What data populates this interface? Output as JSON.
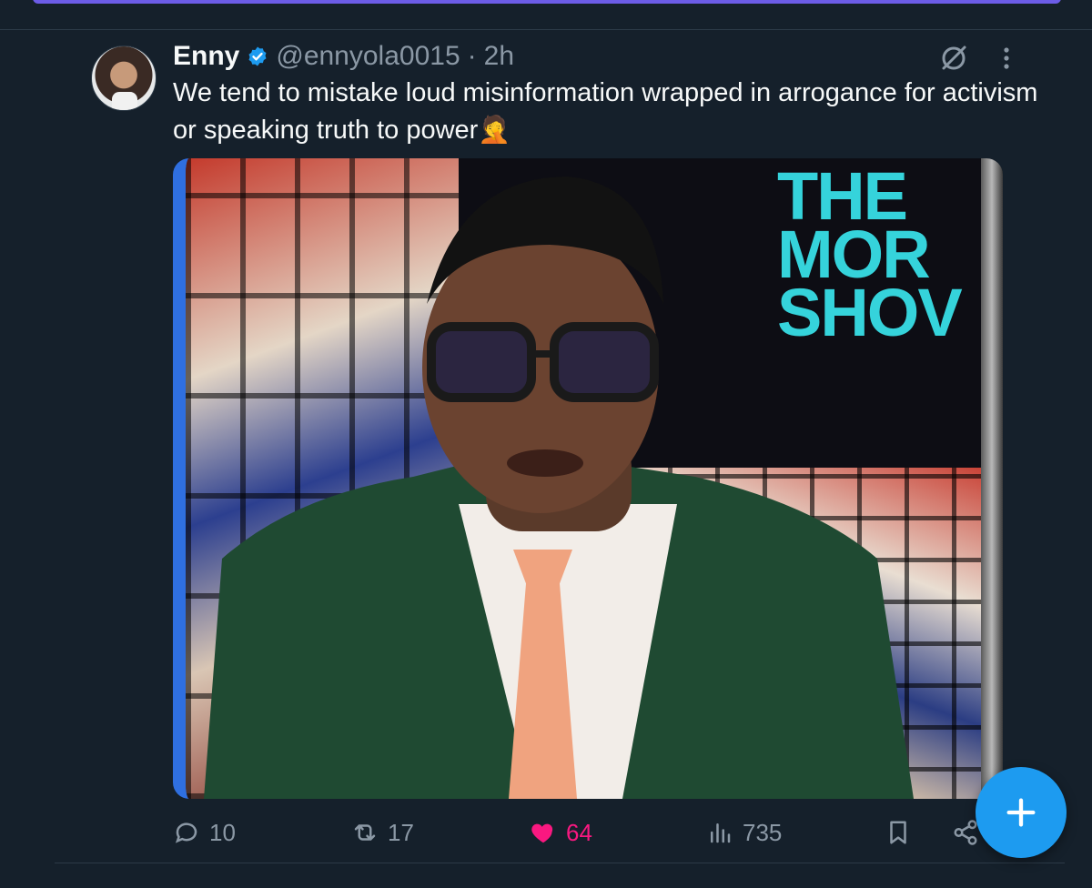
{
  "tweet": {
    "author_name": "Enny",
    "handle": "@ennyola0015",
    "separator": "·",
    "time": "2h",
    "text": "We tend to mistake loud misinformation wrapped in arrogance for activism or speaking truth to power🤦",
    "media_overlay_text": "THE\nMOR\nSHOV"
  },
  "actions": {
    "replies": "10",
    "reposts": "17",
    "likes": "64",
    "views": "735"
  },
  "colors": {
    "background": "#15202b",
    "accent": "#1d9bf0",
    "like": "#f91880",
    "secondary_text": "#8b98a5"
  },
  "icons": [
    "verified-badge-icon",
    "grok-icon",
    "more-icon",
    "reply-icon",
    "repost-icon",
    "heart-icon",
    "views-icon",
    "bookmark-icon",
    "share-icon",
    "plus-icon"
  ]
}
